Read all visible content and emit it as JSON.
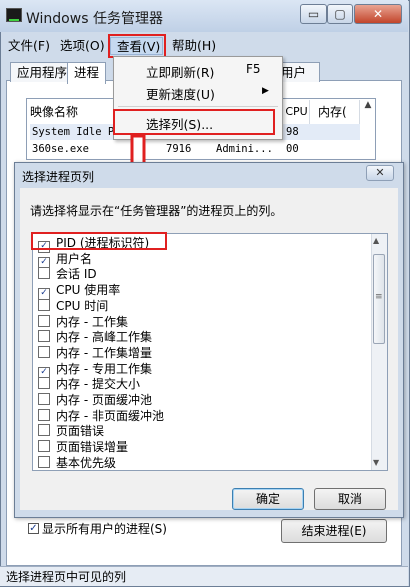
{
  "window": {
    "title": "Windows 任务管理器",
    "controls": {
      "minimize": "▭",
      "maximize": "▢",
      "close": "✕"
    }
  },
  "menubar": [
    "文件(F)",
    "选项(O)",
    "查看(V)",
    "帮助(H)"
  ],
  "tabs": {
    "apps": "应用程序",
    "processes": "进程",
    "users": "用户"
  },
  "process_list": {
    "columns": {
      "name": "映像名称",
      "cpu": "CPU",
      "mem": "内存("
    },
    "rows": [
      {
        "name": "System Idle P",
        "cpu": "98"
      },
      {
        "name": "360se.exe",
        "pid": "7916",
        "user": "Admini...",
        "cpu": "00"
      }
    ]
  },
  "view_menu": {
    "refresh_now": "立即刷新(R)",
    "refresh_shortcut": "F5",
    "update_speed": "更新速度(U)",
    "select_columns": "选择列(S)..."
  },
  "dialog": {
    "title": "选择进程页列",
    "close": "✕",
    "instruction": "请选择将显示在“任务管理器”的进程页上的列。",
    "columns": [
      {
        "label": "PID (进程标识符)",
        "checked": true
      },
      {
        "label": "用户名",
        "checked": true
      },
      {
        "label": "会话 ID",
        "checked": false
      },
      {
        "label": "CPU 使用率",
        "checked": true
      },
      {
        "label": "CPU 时间",
        "checked": false
      },
      {
        "label": "内存 - 工作集",
        "checked": false
      },
      {
        "label": "内存 - 高峰工作集",
        "checked": false
      },
      {
        "label": "内存 - 工作集增量",
        "checked": false
      },
      {
        "label": "内存 - 专用工作集",
        "checked": true
      },
      {
        "label": "内存 - 提交大小",
        "checked": false
      },
      {
        "label": "内存 - 页面缓冲池",
        "checked": false
      },
      {
        "label": "内存 - 非页面缓冲池",
        "checked": false
      },
      {
        "label": "页面错误",
        "checked": false
      },
      {
        "label": "页面错误增量",
        "checked": false
      },
      {
        "label": "基本优先级",
        "checked": false
      }
    ],
    "ok": "确定",
    "cancel": "取消"
  },
  "show_all_processes": {
    "label": "显示所有用户的进程(S)",
    "checked": true
  },
  "end_process": "结束进程(E)",
  "statusbar": "选择进程页中可见的列",
  "colors": {
    "highlight_red": "#e02020",
    "frame": "#cfdbea"
  }
}
